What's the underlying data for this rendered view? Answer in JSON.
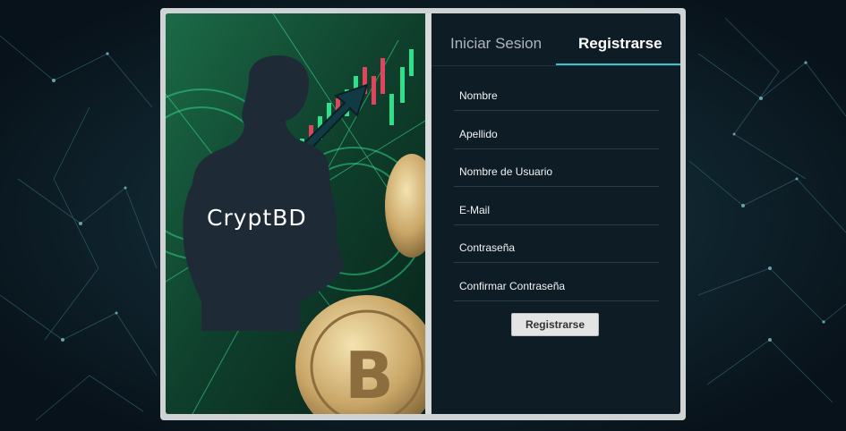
{
  "brand": {
    "name": "CryptBD"
  },
  "tabs": [
    {
      "label": "Iniciar Sesion",
      "active": false
    },
    {
      "label": "Registrarse",
      "active": true
    }
  ],
  "form": {
    "fields": [
      {
        "placeholder": "Nombre"
      },
      {
        "placeholder": "Apellido"
      },
      {
        "placeholder": "Nombre de Usuario"
      },
      {
        "placeholder": "E-Mail"
      },
      {
        "placeholder": "Contraseña"
      },
      {
        "placeholder": "Confirmar Contraseña"
      }
    ],
    "submit_label": "Registrarse"
  },
  "colors": {
    "accent": "#3fc1c9",
    "panel": "#0e1c25",
    "button": "#e4e4e4"
  }
}
